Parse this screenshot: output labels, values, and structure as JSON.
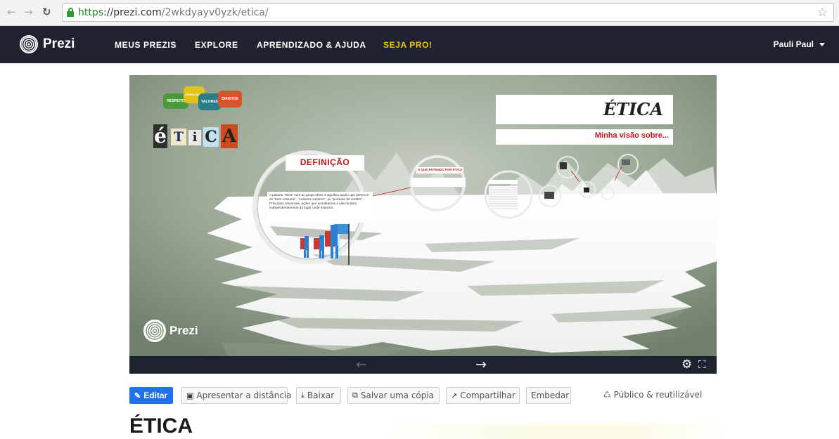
{
  "browser": {
    "url_scheme": "https",
    "url_host": "://prezi.com",
    "url_path": "/2wkdyayv0yzk/etica/"
  },
  "nav": {
    "logo_text": "Prezi",
    "links": [
      "MEUS PREZIS",
      "EXPLORE",
      "APRENDIZADO & AJUDA",
      "SEJA PRO!"
    ],
    "user": "Pauli Paul"
  },
  "slide": {
    "title": "ÉTICA",
    "subtitle": "Minha visão sobre...",
    "definition_heading": "DEFINIÇÃO",
    "definition_text": "A palavra \"ética\" vem do grego ēthos e significa aquilo que pertence ao \"bom costume\", \"costume superior\", ou \"portador de caráter\". Princípios universais, ações que acreditamos e não mudam independentemente do lugar onde estamos.",
    "small_heading": "O QUE ENTENDO POR ÉTICA",
    "collage_bubbles": [
      "RESPEITO",
      "HONESTIDADE",
      "VALORES",
      "DIREITOS"
    ],
    "collage_letters": [
      "é",
      "T",
      "i",
      "C",
      "A"
    ],
    "watermark": "Prezi"
  },
  "controls": {
    "prev_icon": "arrow-left-icon",
    "next_icon": "arrow-right-icon"
  },
  "actions": {
    "edit": "Editar",
    "present_remote": "Apresentar a distância",
    "download": "Baixar",
    "save_copy": "Salvar uma cópia",
    "share": "Compartilhar",
    "embed": "Embedar",
    "public_label": "Público & reutilizável"
  },
  "page_title": "ÉTICA",
  "colors": {
    "nav_bg": "#1f2330",
    "accent_pro": "#f3c20f",
    "primary_button": "#1e73e8",
    "slide_red": "#c4161c"
  }
}
